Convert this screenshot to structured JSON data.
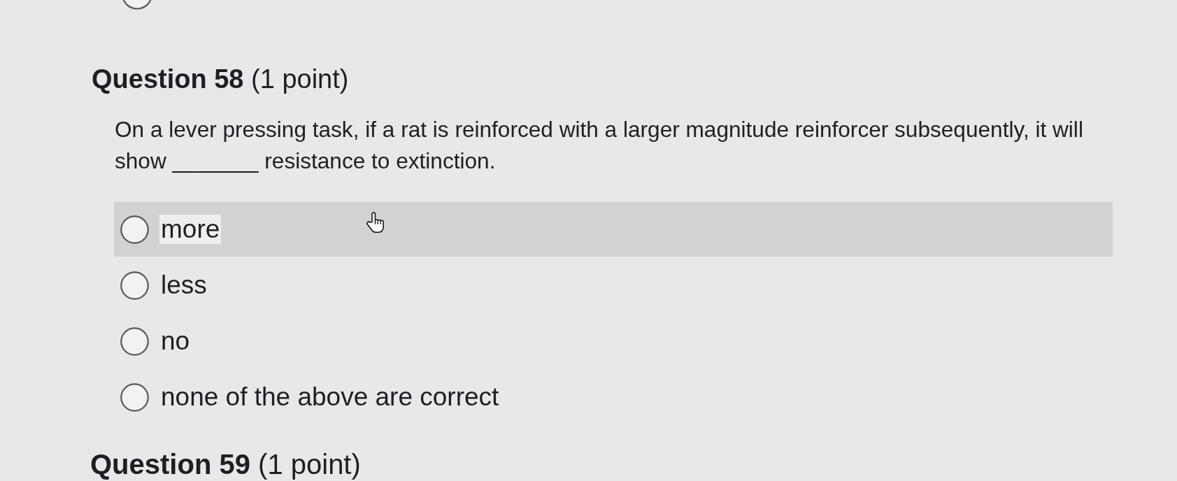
{
  "previous_question": {
    "options": [
      {
        "selected": false
      }
    ]
  },
  "question": {
    "title": "**Question 58** (1 point)",
    "text": "On a lever pressing task, if a rat is reinforced with a larger magnitude reinforcer subsequently, it will show _______ resistance to extinction.",
    "options": [
      {
        "label": "more",
        "selected": false,
        "hovered": true
      },
      {
        "label": "less",
        "selected": false,
        "hovered": false
      },
      {
        "label": "no",
        "selected": false,
        "hovered": false
      },
      {
        "label": "none of the above are correct",
        "selected": false,
        "hovered": false
      }
    ]
  },
  "next_question": {
    "title": "**Question 59** (1 point)"
  }
}
